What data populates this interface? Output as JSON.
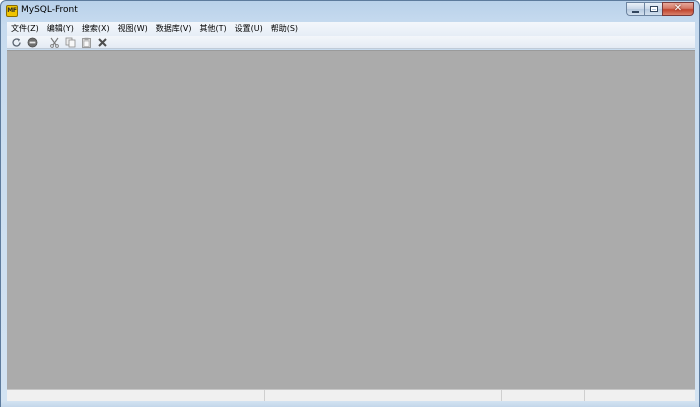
{
  "window": {
    "title": "MySQL-Front",
    "app_icon_text": "MF"
  },
  "caption": {
    "minimize_icon": "minimize-icon",
    "maximize_icon": "maximize-icon",
    "close_icon": "close-icon",
    "close_glyph": "✕"
  },
  "menubar": {
    "items": [
      {
        "label": "文件(Z)"
      },
      {
        "label": "编辑(Y)"
      },
      {
        "label": "搜索(X)"
      },
      {
        "label": "视图(W)"
      },
      {
        "label": "数据库(V)"
      },
      {
        "label": "其他(T)"
      },
      {
        "label": "设置(U)"
      },
      {
        "label": "帮助(S)"
      }
    ]
  },
  "toolbar": {
    "buttons": [
      {
        "icon": "refresh-icon"
      },
      {
        "icon": "stop-icon"
      },
      {
        "icon": "cut-icon"
      },
      {
        "icon": "copy-icon"
      },
      {
        "icon": "paste-icon"
      },
      {
        "icon": "delete-icon"
      }
    ]
  },
  "colors": {
    "client_background": "#ababab",
    "frame": "#c7dbef"
  }
}
